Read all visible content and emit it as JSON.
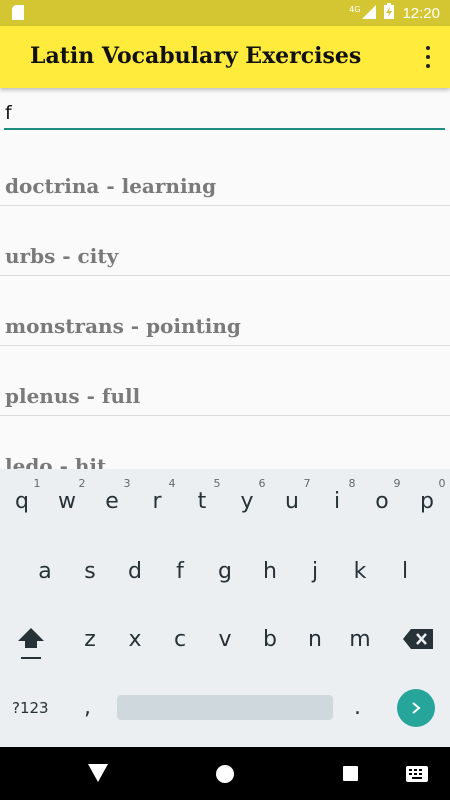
{
  "status_bar": {
    "network": "4G",
    "time": "12:20"
  },
  "app_bar": {
    "title": "Latin Vocabulary Exercises"
  },
  "search": {
    "value": "f"
  },
  "words": [
    "doctrina - learning",
    "urbs - city",
    "monstrans - pointing",
    "plenus - full",
    "ledo - hit"
  ],
  "keyboard": {
    "row1": [
      "q",
      "w",
      "e",
      "r",
      "t",
      "y",
      "u",
      "i",
      "o",
      "p"
    ],
    "row1_hints": [
      "1",
      "2",
      "3",
      "4",
      "5",
      "6",
      "7",
      "8",
      "9",
      "0"
    ],
    "row2": [
      "a",
      "s",
      "d",
      "f",
      "g",
      "h",
      "j",
      "k",
      "l"
    ],
    "row3": [
      "z",
      "x",
      "c",
      "v",
      "b",
      "n",
      "m"
    ],
    "symbols_label": "?123",
    "comma": ",",
    "period": "."
  },
  "colors": {
    "status_bar": "#d4c632",
    "app_bar": "#ffeb3b",
    "accent": "#1e8c7e",
    "enter_key": "#26a69a"
  }
}
